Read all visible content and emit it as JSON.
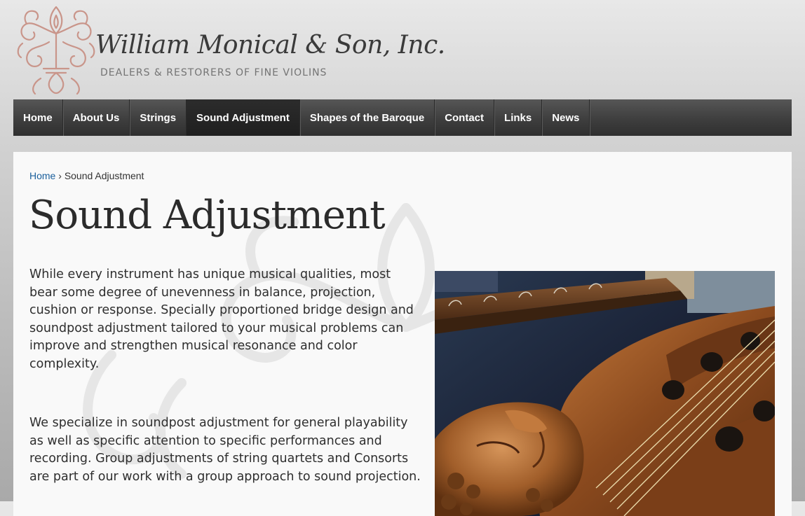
{
  "header": {
    "logo_title": "William Monical & Son, Inc.",
    "logo_tagline": "DEALERS & RESTORERS OF FINE VIOLINS",
    "emblem_icon": "fleur-de-lis-icon",
    "emblem_color": "#c9958a"
  },
  "nav": {
    "items": [
      {
        "label": "Home"
      },
      {
        "label": "About Us"
      },
      {
        "label": "Strings"
      },
      {
        "label": "Sound Adjustment",
        "active": true
      },
      {
        "label": "Shapes of the Baroque"
      },
      {
        "label": "Contact"
      },
      {
        "label": "Links"
      },
      {
        "label": "News"
      }
    ]
  },
  "breadcrumb": {
    "home": "Home",
    "separator": "›",
    "current": "Sound Adjustment"
  },
  "page": {
    "title": "Sound Adjustment",
    "paragraphs": [
      "While every instrument has unique musical qualities, most bear some degree of unevenness in balance, projection, cushion or response. Specially proportioned bridge design and soundpost adjustment tailored to your musical problems can improve and strengthen musical resonance and color complexity.",
      "We specialize in soundpost adjustment for general playability as well as specific attention to specific performances and recording. Group adjustments of string quartets and Consorts are part of our work with a group approach to sound projection."
    ],
    "photo_subject": "carved-scroll-viola-da-gamba-image"
  },
  "colors": {
    "nav_background": "#3e3e3e",
    "nav_active": "#1f1f1f",
    "link": "#1a5f9c",
    "text": "#2e2e2e"
  }
}
